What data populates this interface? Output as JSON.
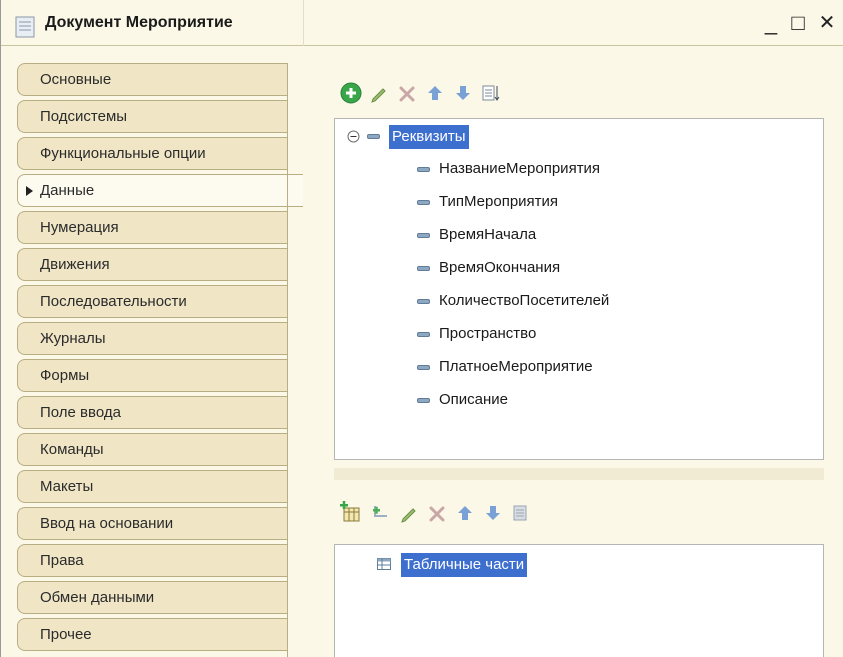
{
  "window": {
    "title": "Документ Мероприятие",
    "controls": {
      "minimize": "_",
      "maximize": "□",
      "close": "✕"
    }
  },
  "sidebar": {
    "items": [
      {
        "label": "Основные"
      },
      {
        "label": "Подсистемы"
      },
      {
        "label": "Функциональные опции"
      },
      {
        "label": "Данные",
        "active": true
      },
      {
        "label": "Нумерация"
      },
      {
        "label": "Движения"
      },
      {
        "label": "Последовательности"
      },
      {
        "label": "Журналы"
      },
      {
        "label": "Формы"
      },
      {
        "label": "Поле ввода"
      },
      {
        "label": "Команды"
      },
      {
        "label": "Макеты"
      },
      {
        "label": "Ввод на основании"
      },
      {
        "label": "Права"
      },
      {
        "label": "Обмен данными"
      },
      {
        "label": "Прочее"
      }
    ]
  },
  "attributes_toolbar": {
    "buttons": [
      "add-icon",
      "edit-pencil-icon",
      "delete-x-icon",
      "move-up-icon",
      "move-down-icon",
      "sort-list-icon"
    ]
  },
  "attributes_tree": {
    "root": "Реквизиты",
    "children": [
      "НазваниеМероприятия",
      "ТипМероприятия",
      "ВремяНачала",
      "ВремяОкончания",
      "КоличествоПосетителей",
      "Пространство",
      "ПлатноеМероприятие",
      "Описание"
    ]
  },
  "tabular_toolbar": {
    "buttons": [
      "add-table-icon",
      "add-subitem-icon",
      "edit-pencil-icon",
      "delete-x-icon",
      "move-up-icon",
      "move-down-icon",
      "sort-list-icon"
    ]
  },
  "tabular_tree": {
    "root": "Табличные части"
  },
  "colors": {
    "window_bg": "#fbf8e7",
    "tab_bg": "#f0e6c6",
    "selection": "#3d6fcf",
    "add_green": "#3aa64a",
    "arrow_blue": "#7aa1d6"
  }
}
